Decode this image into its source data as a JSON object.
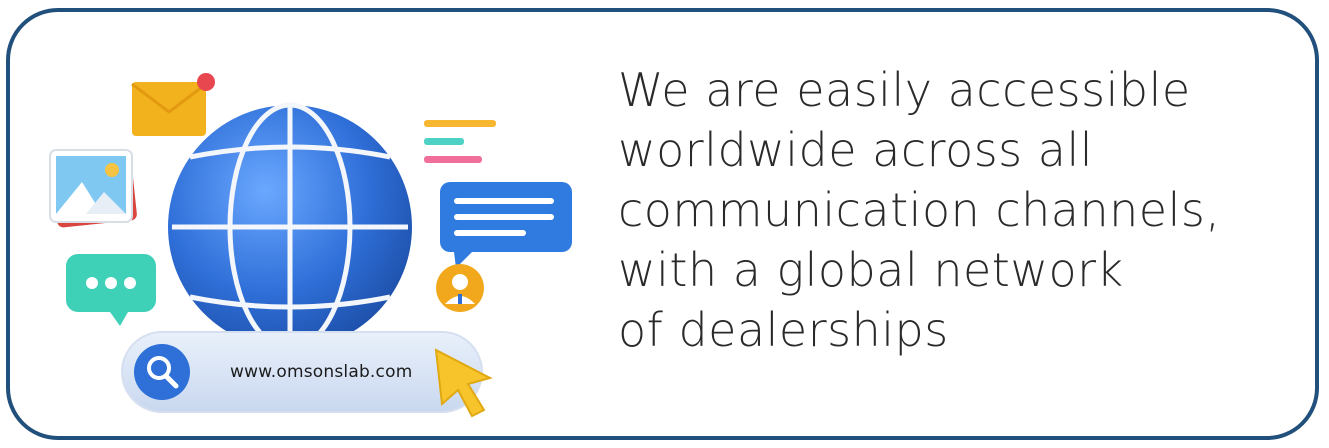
{
  "illustration": {
    "url": "www.omsonslab.com",
    "icons": [
      "envelope-icon",
      "photo-icon",
      "chat-dots-icon",
      "globe-icon",
      "text-lines-icon",
      "message-bubble-icon",
      "user-avatar-icon",
      "search-icon",
      "cursor-pointer-icon"
    ]
  },
  "headline": {
    "lines": [
      "We are easily accessible",
      "worldwide across all",
      "communication channels,",
      "with a global network",
      "of dealerships"
    ]
  },
  "colors": {
    "border": "#22507c",
    "globe": "#2f6fd8",
    "text": "#2a2a2a"
  }
}
